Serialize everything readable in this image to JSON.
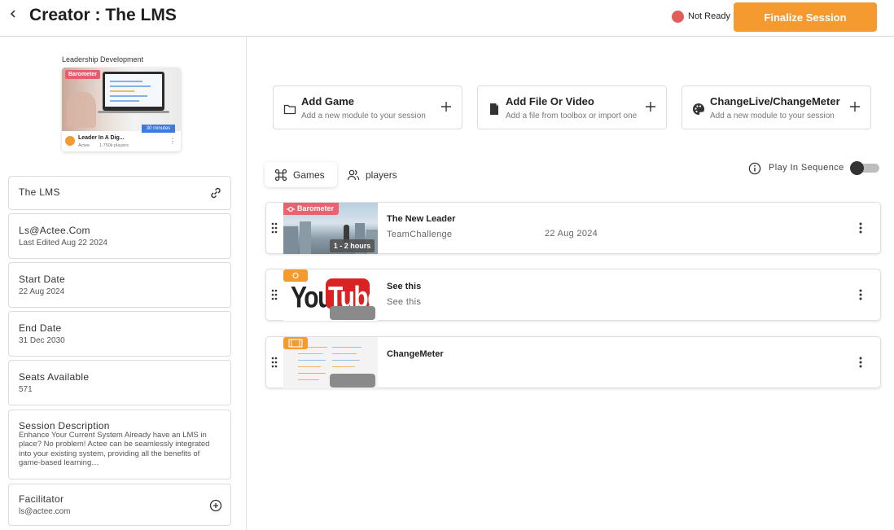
{
  "header": {
    "title": "Creator : The LMS",
    "status_text": "Not Ready",
    "status_color": "#e35d5d",
    "finalize_label": "Finalize Session",
    "accent_color": "#f59a2f"
  },
  "sidebar": {
    "course_label": "Leadership Development",
    "course_card": {
      "badge": "Barometer",
      "duration": "30 minutes",
      "name": "Leader In A Dig...",
      "author": "Actee",
      "players": "1.750k players"
    },
    "fields": [
      {
        "label": "The LMS",
        "value": "",
        "icon": "link-icon"
      },
      {
        "label": "Ls@Actee.Com",
        "value": "Last Edited Aug 22 2024"
      },
      {
        "label": "Start Date",
        "value": "22 Aug 2024"
      },
      {
        "label": "End Date",
        "value": "31 Dec 2030"
      },
      {
        "label": "Seats Available",
        "value": "571"
      },
      {
        "label": "Session Description",
        "value": "Enhance Your Current System Already have an LMS in place? No problem! Actee can be seamlessly integrated into your existing system, providing all the benefits of game-based learning…"
      },
      {
        "label": "Facilitator",
        "value": "ls@actee.com",
        "icon": "add-circle-icon"
      }
    ]
  },
  "actions": [
    {
      "title": "Add Game",
      "subtitle": "Add a new module to your session",
      "icon": "folder-icon"
    },
    {
      "title": "Add File Or Video",
      "subtitle": "Add a file from toolbox or import one",
      "icon": "file-icon"
    },
    {
      "title": "ChangeLive/ChangeMeter",
      "subtitle": "Add a new module to your session",
      "icon": "palette-icon"
    }
  ],
  "tabs": [
    {
      "label": "Games",
      "icon": "command-icon",
      "active": true
    },
    {
      "label": "players",
      "icon": "users-icon",
      "active": false
    }
  ],
  "sequence": {
    "label": "Play In Sequence",
    "enabled": false
  },
  "games": [
    {
      "title": "The New Leader",
      "subtitle": "TeamChallenge",
      "date": "22 Aug 2024",
      "badge": "Barometer",
      "duration": "1 - 2 hours",
      "thumb": "city-image"
    },
    {
      "title": "See this",
      "subtitle": "See this",
      "date": "",
      "thumb": "youtube-image",
      "logo_you": "You",
      "logo_tube": "Tube"
    },
    {
      "title": "ChangeMeter",
      "subtitle": "",
      "date": "",
      "thumb": "document-image"
    }
  ]
}
